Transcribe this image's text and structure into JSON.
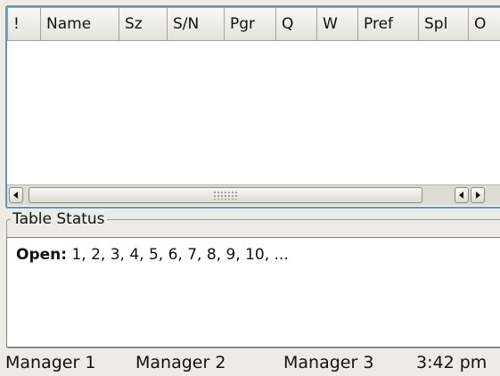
{
  "table": {
    "columns": [
      "!",
      "Name",
      "Sz",
      "S/N",
      "Pgr",
      "Q",
      "W",
      "Pref",
      "Spl",
      "O"
    ],
    "rows": []
  },
  "status": {
    "title": "Table Status",
    "open_label": "Open:",
    "open_values": " 1, 2, 3, 4, 5, 6, 7, 8, 9, 10, ..."
  },
  "bottom_bar": {
    "managers": [
      "Manager 1",
      "Manager 2",
      "Manager 3"
    ],
    "time": "3:42 pm"
  },
  "colors": {
    "panel_border": "#6b93ad",
    "window_background": "#ecebe8",
    "content_background": "#ffffff"
  },
  "icons": {
    "scroll_left": "arrow-left-icon",
    "scroll_right": "arrow-right-icon",
    "thumb_grip": "grip-icon"
  }
}
